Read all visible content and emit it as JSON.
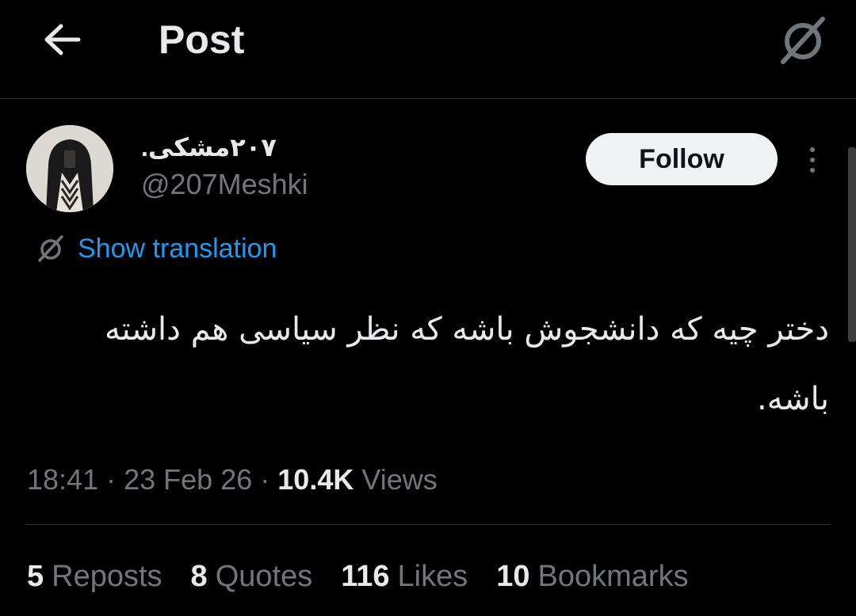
{
  "header": {
    "title": "Post",
    "back_icon": "arrow-left-icon",
    "grok_icon": "grok-icon"
  },
  "author": {
    "display_name": "۲۰۷مشکی.",
    "handle": "@207Meshki",
    "follow_label": "Follow",
    "more_icon": "more-vertical-icon"
  },
  "translation": {
    "label": "Show translation",
    "icon": "grok-icon"
  },
  "tweet": {
    "text": "دختر چیه که دانشجوش باشه که نظر سیاسی هم داشته باشه."
  },
  "meta": {
    "time": "18:41",
    "date": "23 Feb 26",
    "views_count": "10.4K",
    "views_label": "Views",
    "separator": "·"
  },
  "stats": [
    {
      "count": "5",
      "label": "Reposts"
    },
    {
      "count": "8",
      "label": "Quotes"
    },
    {
      "count": "116",
      "label": "Likes"
    },
    {
      "count": "10",
      "label": "Bookmarks"
    }
  ],
  "colors": {
    "background": "#000000",
    "text": "#e7e9ea",
    "secondary": "#71767b",
    "link": "#1d9bf0",
    "follow_bg": "#eff3f4"
  }
}
